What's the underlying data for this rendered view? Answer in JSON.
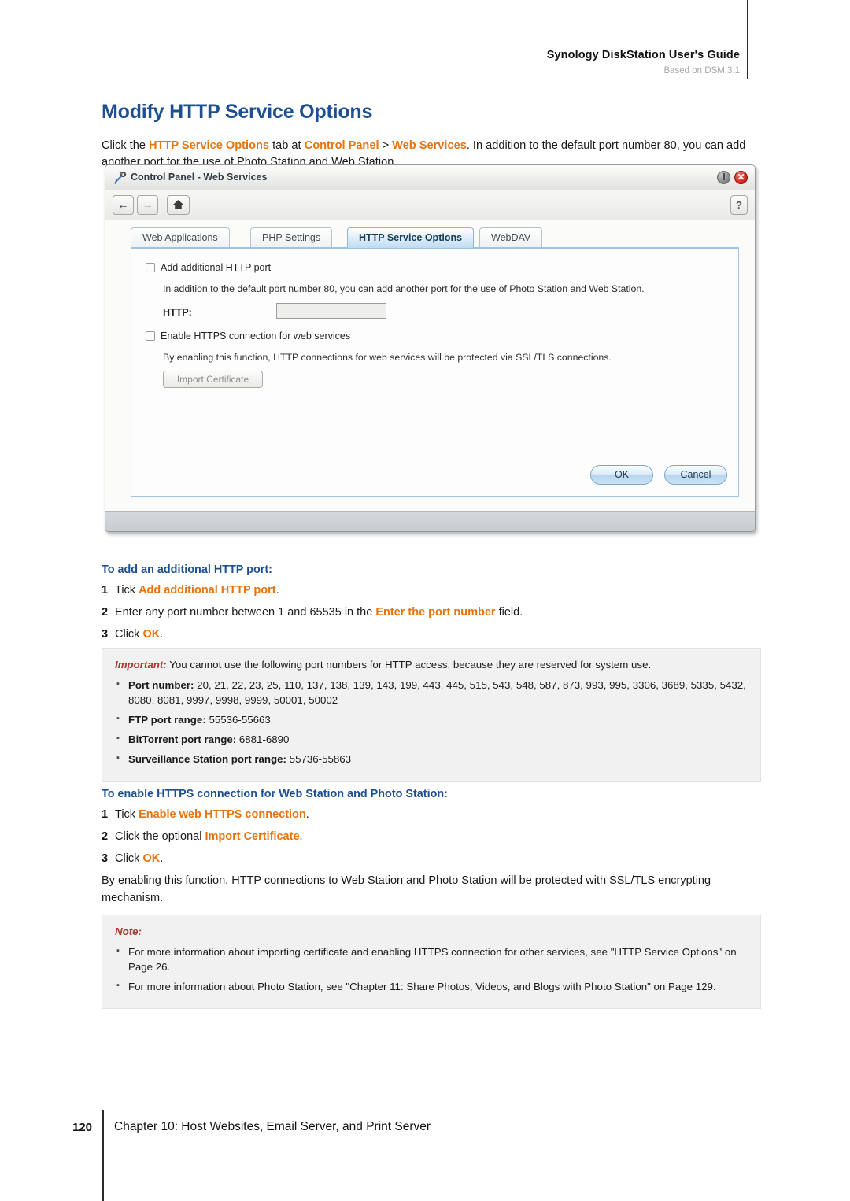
{
  "header": {
    "title": "Synology DiskStation User's Guide",
    "subtitle": "Based on DSM 3.1"
  },
  "page_title": "Modify HTTP Service Options",
  "intro": {
    "p1": "Click the ",
    "kw1": "HTTP Service Options",
    "p2": " tab at ",
    "kw2": "Control Panel",
    "p3": " > ",
    "kw3": "Web Services",
    "p4": ". In addition to the default port number 80, you can add another port for the use of Photo Station and Web Station."
  },
  "screenshot": {
    "window_title": "Control Panel - Web Services",
    "icon": "tools-icon",
    "titlebar_buttons": {
      "minimize": "minimize-button",
      "close": "✕"
    },
    "toolbar": {
      "back": "←",
      "forward": "→",
      "home": "⌂",
      "help": "?"
    },
    "tabs": [
      {
        "label": "Web Applications",
        "active": false
      },
      {
        "label": "PHP Settings",
        "active": false
      },
      {
        "label": "HTTP Service Options",
        "active": true
      },
      {
        "label": "WebDAV",
        "active": false
      }
    ],
    "form": {
      "checkbox1_label": "Add additional HTTP port",
      "checkbox1_checked": false,
      "desc1": "In addition to the default port number 80, you can add another port for the use of Photo Station and Web Station.",
      "http_label": "HTTP:",
      "http_value": "",
      "checkbox2_label": "Enable HTTPS connection for web services",
      "checkbox2_checked": false,
      "desc2": "By enabling this function, HTTP connections for web services will be protected via SSL/TLS connections.",
      "import_button": "Import Certificate"
    },
    "buttons": {
      "ok": "OK",
      "cancel": "Cancel"
    }
  },
  "procedure_http": {
    "heading": "To add an additional HTTP port:",
    "steps": [
      {
        "num": "1",
        "pre": "Tick ",
        "kw": "Add additional HTTP port",
        "post": "."
      },
      {
        "num": "2",
        "pre": "Enter any port number between 1 and 65535 in the ",
        "kw": "Enter the port number",
        "post": " field."
      },
      {
        "num": "3",
        "pre": "Click ",
        "kw": "OK",
        "post": "."
      }
    ]
  },
  "important_box": {
    "keyword": "Important:",
    "lead": " You cannot use the following port numbers for HTTP access, because they are reserved for system use.",
    "items": [
      {
        "label": "Port number:",
        "value": " 20, 21, 22, 23, 25, 110, 137, 138, 139, 143, 199, 443, 445, 515, 543, 548, 587, 873, 993, 995, 3306, 3689, 5335, 5432, 8080, 8081, 9997, 9998, 9999, 50001, 50002"
      },
      {
        "label": "FTP port range:",
        "value": " 55536-55663"
      },
      {
        "label": "BitTorrent port range:",
        "value": " 6881-6890"
      },
      {
        "label": "Surveillance Station port range:",
        "value": " 55736-55863"
      }
    ]
  },
  "procedure_https": {
    "heading": "To enable HTTPS connection for Web Station and Photo Station:",
    "steps": [
      {
        "num": "1",
        "pre": "Tick ",
        "kw": "Enable web HTTPS connection",
        "post": "."
      },
      {
        "num": "2",
        "pre": "Click the optional ",
        "kw": "Import Certificate",
        "post": "."
      },
      {
        "num": "3",
        "pre": "Click ",
        "kw": "OK",
        "post": "."
      }
    ],
    "paragraph": "By enabling this function, HTTP connections to Web Station and Photo Station will be protected with SSL/TLS encrypting mechanism."
  },
  "note_box": {
    "keyword": "Note:",
    "items": [
      {
        "label": "",
        "value": "For more information about importing certificate and enabling HTTPS connection for other services, see \"HTTP Service Options\" on Page 26."
      },
      {
        "label": "",
        "value": "For more information about Photo Station, see \"Chapter 11: Share Photos, Videos, and Blogs with Photo Station\" on Page 129."
      }
    ]
  },
  "footer": {
    "page_number": "120",
    "chapter": "Chapter 10: Host Websites, Email Server, and Print Server"
  },
  "colors": {
    "heading_blue": "#1d4f91",
    "keyword_orange": "#e8730d",
    "callout_red": "#a8372c",
    "callout_bg": "#f1f1f1"
  }
}
